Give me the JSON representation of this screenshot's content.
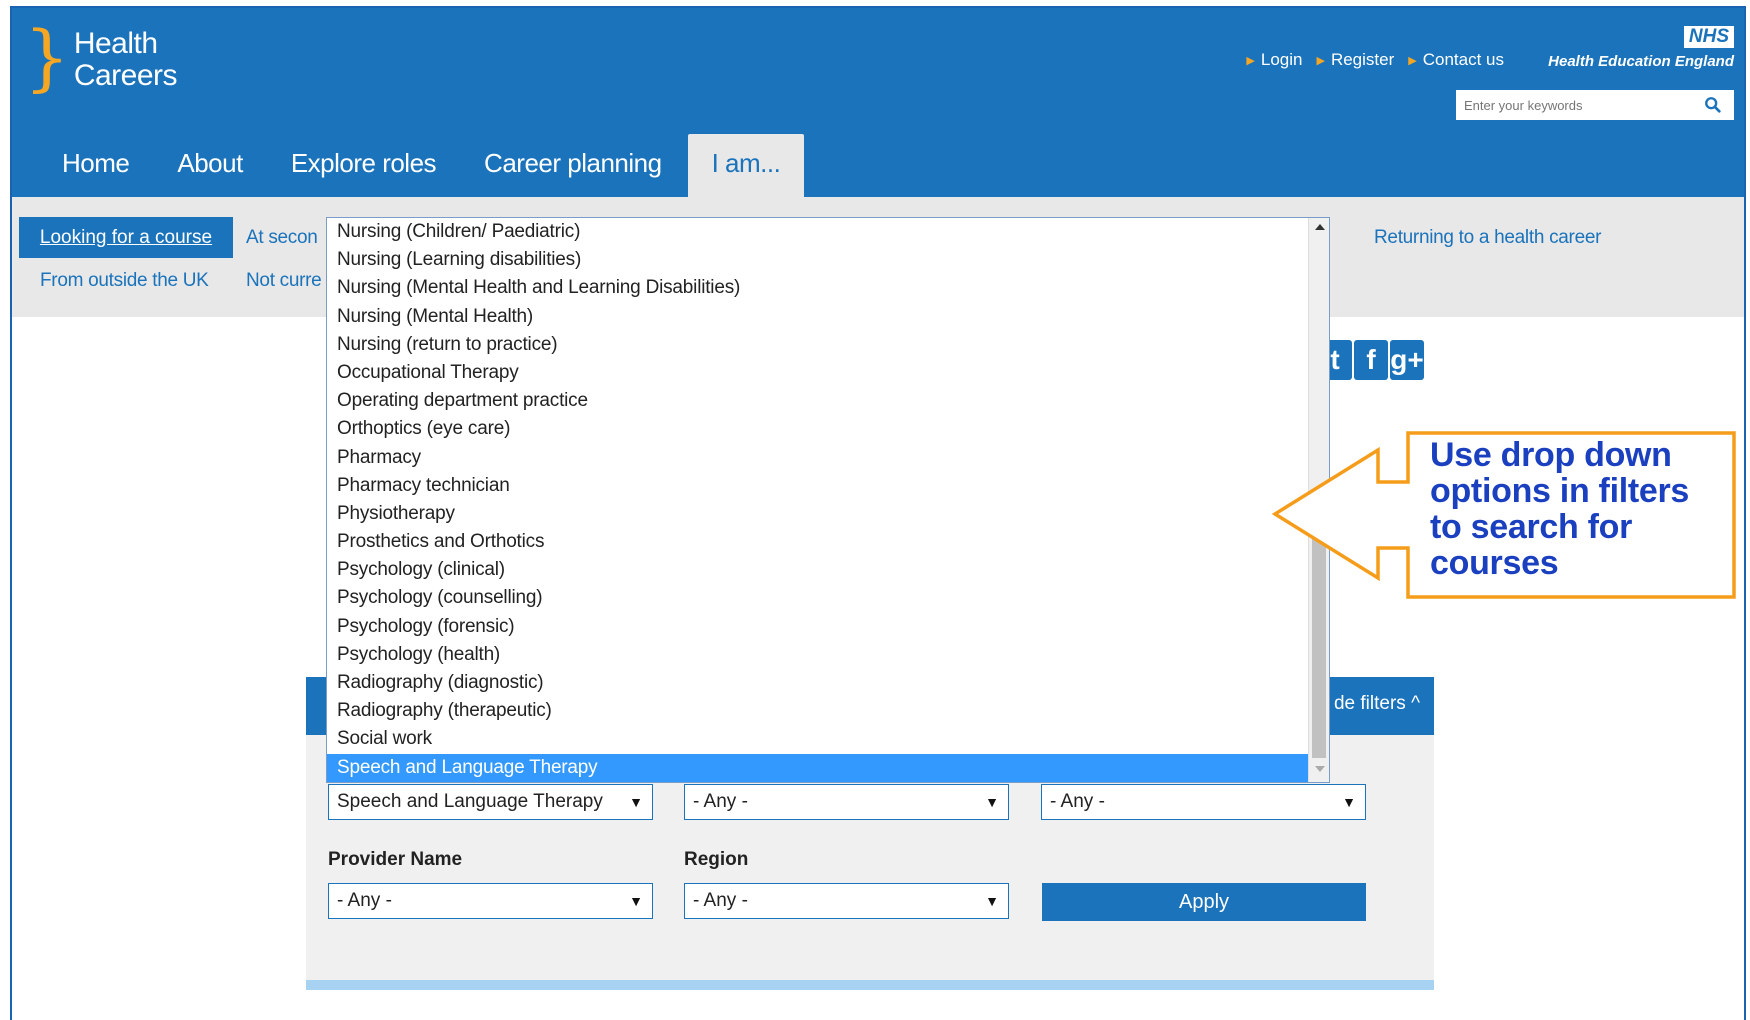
{
  "brand": {
    "logo_line1": "Health",
    "logo_line2": "Careers",
    "nhs": "NHS",
    "hee": "Health Education England"
  },
  "toplinks": {
    "login": "Login",
    "register": "Register",
    "contact": "Contact us"
  },
  "search": {
    "placeholder": "Enter your keywords"
  },
  "nav": [
    "Home",
    "About",
    "Explore roles",
    "Career planning",
    "I am..."
  ],
  "subnav": {
    "active": "Looking for a course",
    "item_secondary": "At secon",
    "item_not_currently": "Not curre",
    "item_outside_uk": "From outside the UK",
    "item_returning": "Returning to a health career"
  },
  "filters": {
    "hide_filters": "de filters ^",
    "course_value": "Speech and Language Therapy",
    "filter2_value": "- Any -",
    "filter3_value": "- Any -",
    "provider_label": "Provider Name",
    "provider_value": "- Any -",
    "region_label": "Region",
    "region_value": "- Any -",
    "apply": "Apply"
  },
  "dropdown": {
    "options": [
      "Nursing (Children/ Paediatric)",
      "Nursing (Learning disabilities)",
      "Nursing (Mental Health and Learning Disabilities)",
      "Nursing (Mental Health)",
      "Nursing (return to practice)",
      "Occupational Therapy",
      "Operating department practice",
      "Orthoptics (eye care)",
      "Pharmacy",
      "Pharmacy technician",
      "Physiotherapy",
      "Prosthetics and Orthotics",
      "Psychology (clinical)",
      "Psychology (counselling)",
      "Psychology (forensic)",
      "Psychology (health)",
      "Radiography (diagnostic)",
      "Radiography (therapeutic)",
      "Social work",
      "Speech and Language Therapy"
    ],
    "selected_index": 19
  },
  "callout": {
    "text": "Use drop down options in filters to search for courses"
  },
  "social": {
    "twitter": "t",
    "facebook": "f",
    "googleplus": "g+"
  },
  "colors": {
    "brand_blue": "#1a73bb",
    "accent_orange": "#f5a623",
    "selection_blue": "#3399ff",
    "callout_text": "#1a3fbf"
  }
}
